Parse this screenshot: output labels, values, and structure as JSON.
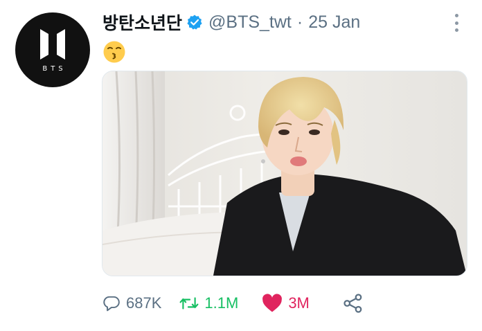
{
  "tweet": {
    "display_name": "방탄소년단",
    "handle": "@BTS_twt",
    "separator": "·",
    "date": "25 Jan",
    "verified": true,
    "content_emoji": "😙",
    "avatar_logo_text": "BTS"
  },
  "actions": {
    "replies": "687K",
    "retweets": "1.1M",
    "likes": "3M"
  },
  "colors": {
    "verified": "#1da1f2",
    "retweet": "#17bf63",
    "like": "#e0245e",
    "muted": "#5b7083"
  },
  "icons": {
    "reply": "reply-icon",
    "retweet": "retweet-icon",
    "like": "heart-icon",
    "share": "share-icon",
    "more": "more-vertical-icon"
  }
}
